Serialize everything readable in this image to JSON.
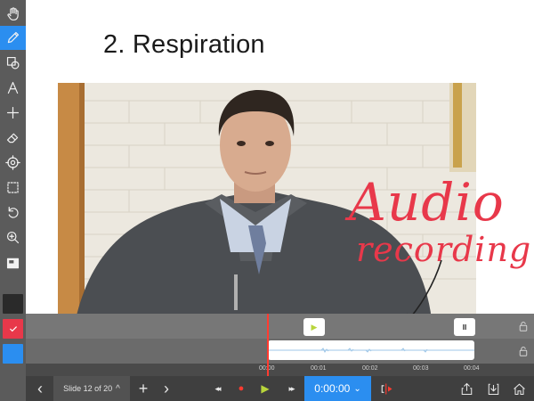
{
  "slide": {
    "title": "2. Respiration",
    "annotation": {
      "line1": "Audio",
      "line2": "recording"
    }
  },
  "sidebar": {
    "tools": [
      "hand-icon",
      "pen-icon",
      "shapes-icon",
      "text-icon",
      "add-icon",
      "eraser-icon",
      "target-icon",
      "selection-icon",
      "undo-icon",
      "zoom-icon",
      "slide-view-icon"
    ],
    "active_tool": "pen-icon",
    "color_swatches": [
      "#2a2a2a",
      "#e8384a",
      "#2b8ef0"
    ]
  },
  "track": {
    "play_label": "▶",
    "pause_label": "II",
    "lock_icon": "lock-icon"
  },
  "timeline": {
    "ticks": [
      "00:00",
      "00:01",
      "00:02",
      "00:03",
      "00:04"
    ]
  },
  "bottombar": {
    "prev": "‹",
    "slide_label": "Slide 12 of 20",
    "slide_caret": "^",
    "add": "+",
    "next": "›",
    "rewind": "◂◂",
    "record": "●",
    "play": "▶",
    "forward": "▸▸",
    "time": "0:00:00",
    "time_caret": "⌄"
  },
  "colors": {
    "accent": "#2b8ef0",
    "annotation": "#e8384a",
    "record": "#ff3b30",
    "play": "#b8d53b"
  }
}
